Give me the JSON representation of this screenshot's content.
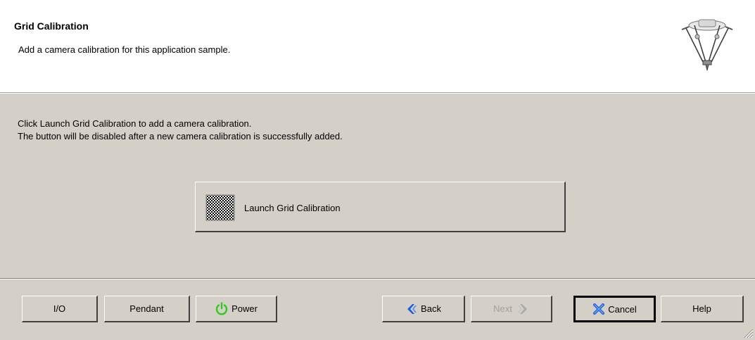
{
  "header": {
    "title": "Grid Calibration",
    "subtitle": "Add a camera calibration for this application sample."
  },
  "content": {
    "instruction_line1": "Click Launch Grid Calibration to add a camera calibration.",
    "instruction_line2": "The button will be disabled after a new camera calibration is successfully added.",
    "launch_button_label": "Launch Grid Calibration"
  },
  "footer": {
    "io_label": "I/O",
    "pendant_label": "Pendant",
    "power_label": "Power",
    "back_label": "Back",
    "next_label": "Next",
    "cancel_label": "Cancel",
    "help_label": "Help",
    "next_enabled": false,
    "focused_button": "Cancel"
  },
  "icons": {
    "header": "delta-robot-icon",
    "launch": "checkerboard-grid-icon",
    "power": "power-icon",
    "back": "back-arrow-icon",
    "next": "next-arrow-icon",
    "cancel": "cancel-x-icon"
  },
  "colors": {
    "window_bg": "#d4d0c8",
    "header_bg": "#ffffff",
    "power_icon": "#2ecc1a",
    "back_arrow": "#1a5fd6",
    "cancel_x": "#1a5fd6",
    "disabled_text": "#a0a0a0"
  }
}
